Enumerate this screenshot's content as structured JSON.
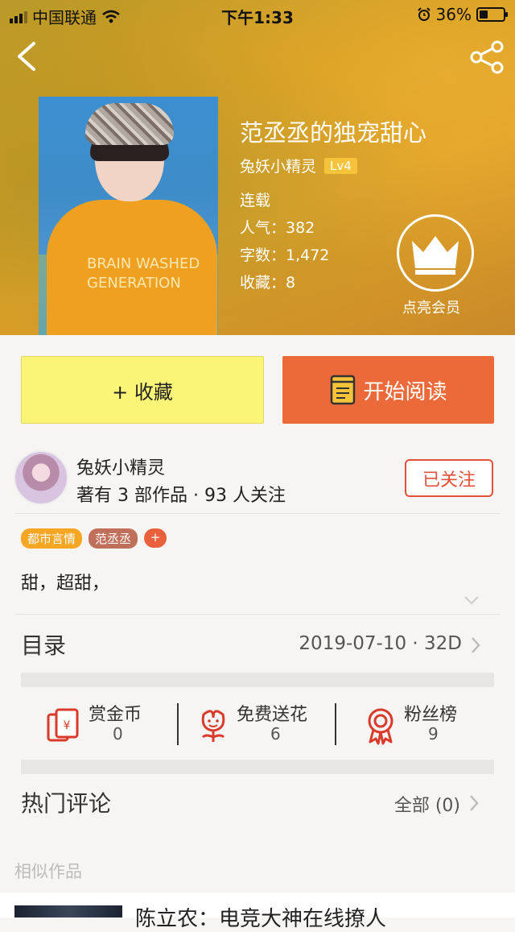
{
  "status_bar": {
    "carrier": "中国联通",
    "time": "下午1:33",
    "battery": "36%",
    "battery_level": 0.36
  },
  "header": {
    "back_icon": "chevron-left-icon",
    "share_icon": "share-icon"
  },
  "book": {
    "title": "范丞丞的独宠甜心",
    "author": "兔妖小精灵",
    "level": "Lv4",
    "status": "连载",
    "popularity": "人气：382",
    "word_count": "字数：1,472",
    "favorites": "收藏：8",
    "vip_label": "点亮会员",
    "cover_text": "BRAIN WASHED\nGENERATION"
  },
  "actions": {
    "favorite_label": "+ 收藏",
    "read_label": "开始阅读"
  },
  "author_card": {
    "name": "兔妖小精灵",
    "stats": "著有 3 部作品 · 93 人关注",
    "follow_label": "已关注"
  },
  "tags": [
    {
      "label": "都市言情",
      "color": "#f5a623"
    },
    {
      "label": "范丞丞",
      "color": "#c0705a"
    }
  ],
  "tag_add_label": "+",
  "description": "甜，超甜，",
  "toc": {
    "title": "目录",
    "info": "2019-07-10 · 32D"
  },
  "stats": [
    {
      "label": "赏金币",
      "value": "0",
      "icon": "red-envelope-icon"
    },
    {
      "label": "免费送花",
      "value": "6",
      "icon": "flower-icon"
    },
    {
      "label": "粉丝榜",
      "value": "9",
      "icon": "ribbon-medal-icon"
    }
  ],
  "comments": {
    "title": "热门评论",
    "all_label": "全部 (0)"
  },
  "similar": {
    "title": "相似作品",
    "first_item_title": "陈立农：电竞大神在线撩人"
  },
  "colors": {
    "accent_orange": "#ec6a3a",
    "favorite_yellow": "#fbf577",
    "follow_red": "#e4503a",
    "icon_red": "#d93a2a"
  }
}
